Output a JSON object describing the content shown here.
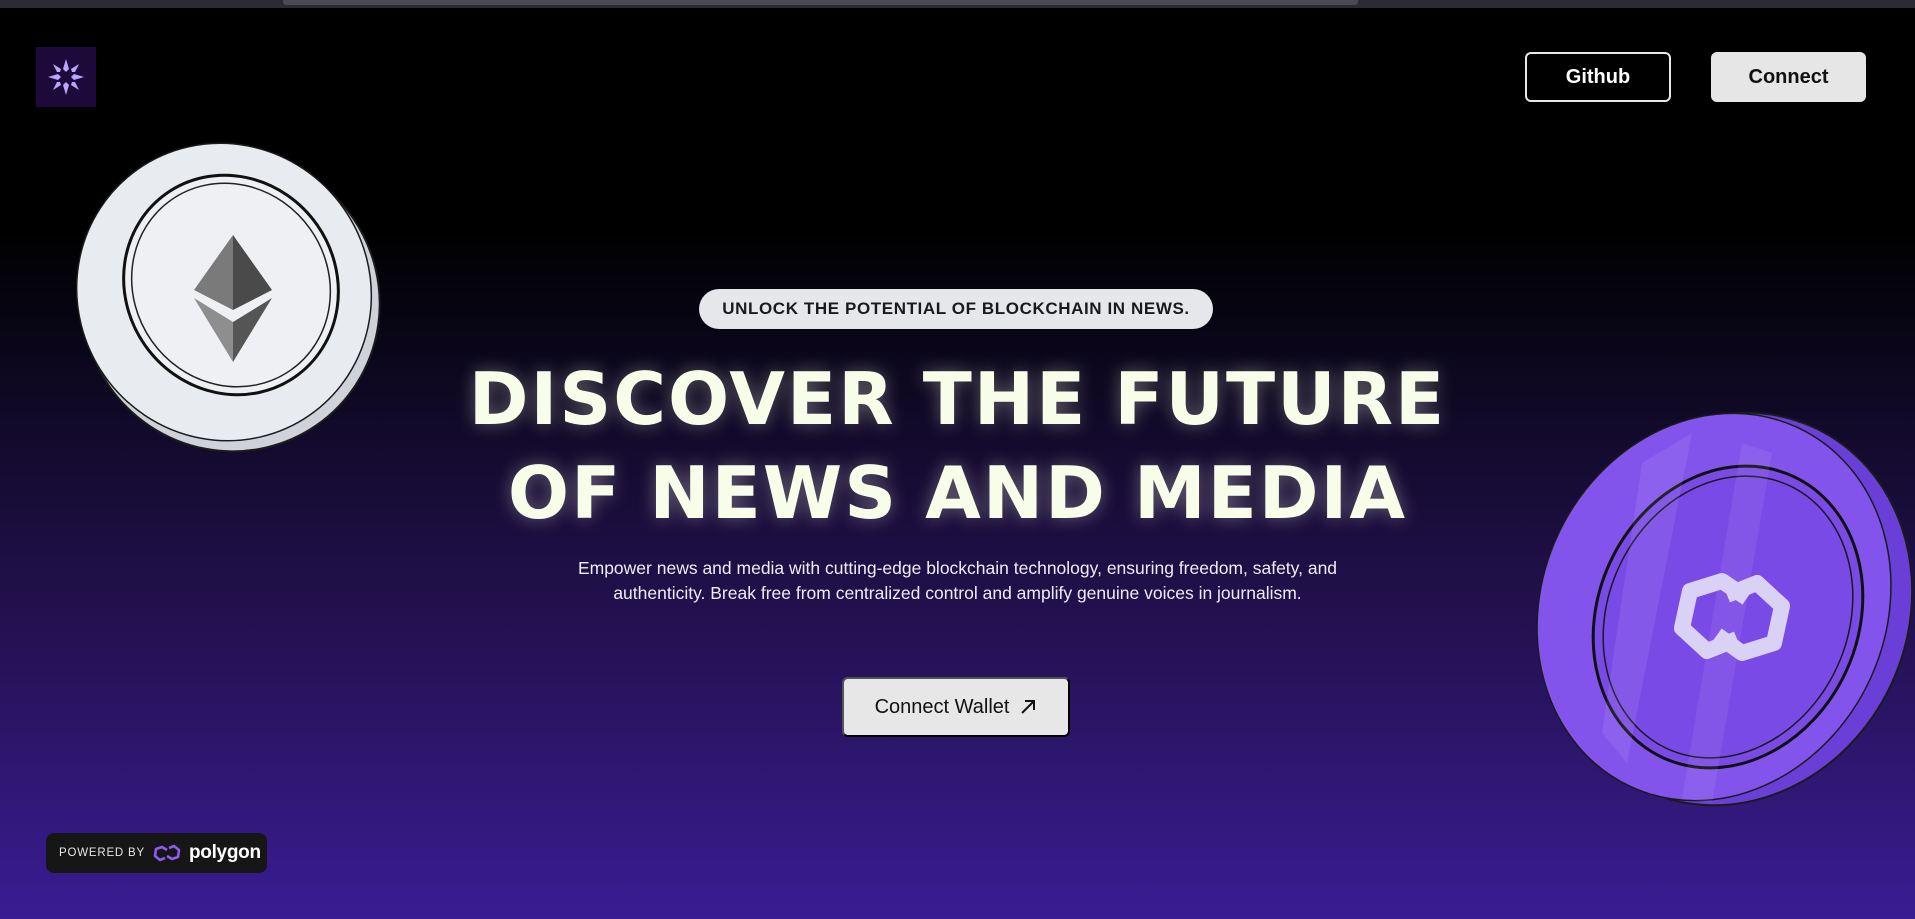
{
  "nav": {
    "logo_icon": "asterisk-flower-logo",
    "github_label": "Github",
    "connect_label": "Connect"
  },
  "hero": {
    "tagline": "UNLOCK THE POTENTIAL OF BLOCKCHAIN IN NEWS.",
    "headline_line1": "DISCOVER THE FUTURE",
    "headline_line2": "OF NEWS AND MEDIA",
    "description": "Empower news and media with cutting-edge blockchain technology, ensuring freedom, safety, and authenticity. Break free from centralized control and amplify genuine voices in journalism.",
    "cta_label": "Connect Wallet",
    "cta_icon": "arrow-up-right-icon"
  },
  "badge": {
    "powered_text": "POWERED BY",
    "brand_text": "polygon",
    "brand_icon": "polygon-logo-icon"
  },
  "colors": {
    "accent_purple": "#7c4dff",
    "headline_text": "#f7fde8",
    "button_light": "#e6e6e6"
  }
}
